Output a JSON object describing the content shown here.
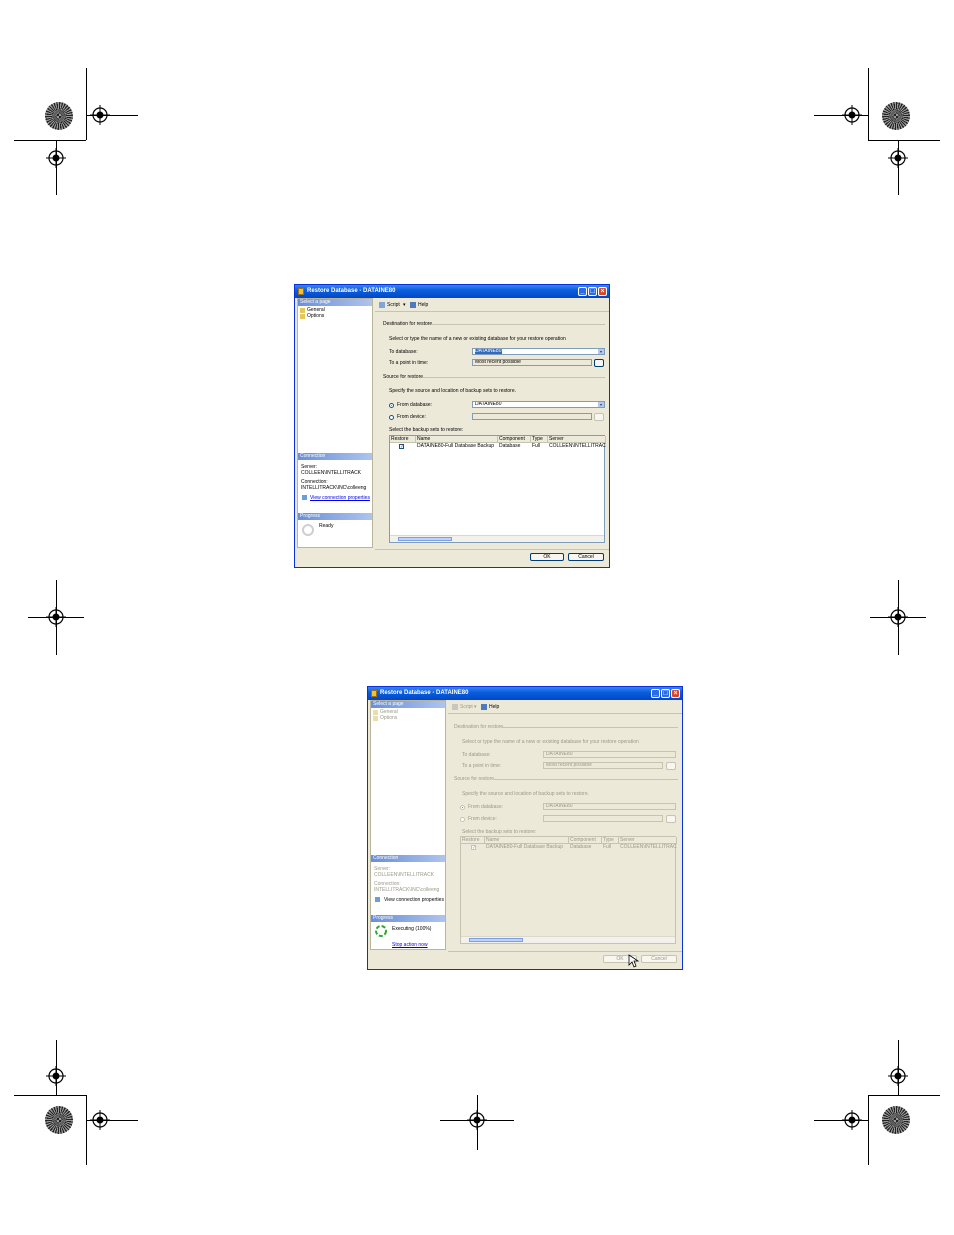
{
  "dialog1": {
    "title": "Restore Database - DATAINE80",
    "left": {
      "select_page_header": "Select a page",
      "pages": [
        "General",
        "Options"
      ],
      "connection_header": "Connection",
      "server_label": "Server:",
      "server_value": "COLLEEN\\INTELLITRACK",
      "connection_label": "Connection:",
      "connection_value": "INTELLITRACK\\INC\\colleeng",
      "view_link": "View connection properties",
      "progress_header": "Progress",
      "progress_status": "Ready"
    },
    "toolbar": {
      "script": "Script",
      "help": "Help"
    },
    "destination_header": "Destination for restore",
    "destination_desc": "Select or type the name of a new or existing database for your restore operation",
    "to_database_label": "To database:",
    "to_database_value": "DATAINE80",
    "point_in_time_label": "To a point in time:",
    "point_in_time_value": "Most recent possible",
    "source_header": "Source for restore",
    "source_desc": "Specify the source and location of backup sets to restore.",
    "from_database_label": "From database:",
    "from_database_value": "DATAINE80",
    "from_device_label": "From device:",
    "backup_sets_label": "Select the backup sets to restore:",
    "columns": [
      "Restore",
      "Name",
      "Component",
      "Type",
      "Server"
    ],
    "row": {
      "restore": "✓",
      "name": "DATAINE80-Full Database Backup",
      "component": "Database",
      "type": "Full",
      "server": "COLLEEN\\INTELLITRAC"
    },
    "ok": "OK",
    "cancel": "Cancel"
  },
  "dialog2": {
    "title": "Restore Database - DATAINE80",
    "left": {
      "select_page_header": "Select a page",
      "pages": [
        "General",
        "Options"
      ],
      "connection_header": "Connection",
      "server_label": "Server:",
      "server_value": "COLLEEN\\INTELLITRACK",
      "connection_label": "Connection:",
      "connection_value": "INTELLITRACK\\INC\\colleeng",
      "view_link": "View connection properties",
      "progress_header": "Progress",
      "progress_status": "Executing (100%)",
      "stop_link": "Stop action now"
    },
    "toolbar": {
      "script": "Script",
      "help": "Help"
    },
    "destination_header": "Destination for restore",
    "destination_desc": "Select or type the name of a new or existing database for your restore operation",
    "to_database_label": "To database:",
    "to_database_value": "DATAINE80",
    "point_in_time_label": "To a point in time:",
    "point_in_time_value": "Most recent possible",
    "source_header": "Source for restore",
    "source_desc": "Specify the source and location of backup sets to restore.",
    "from_database_label": "From database:",
    "from_database_value": "DATAINE80",
    "from_device_label": "From device:",
    "backup_sets_label": "Select the backup sets to restore:",
    "columns": [
      "Restore",
      "Name",
      "Component",
      "Type",
      "Server"
    ],
    "row": {
      "restore": "✓",
      "name": "DATAINE80-Full Database Backup",
      "component": "Database",
      "type": "Full",
      "server": "COLLEEN\\INTELLITRAC"
    },
    "ok": "OK",
    "cancel": "Cancel"
  },
  "icons": [
    "registration-mark",
    "rosette-mark",
    "script-icon",
    "help-icon",
    "page-icon",
    "connection-icon",
    "progress-spinner-icon",
    "cursor-icon"
  ]
}
